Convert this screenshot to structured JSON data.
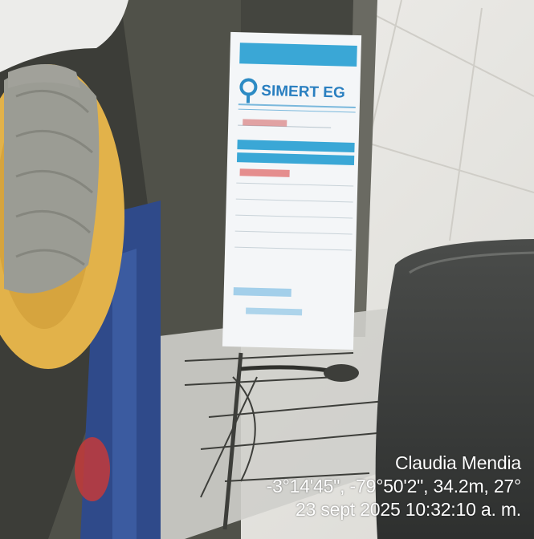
{
  "photo": {
    "description_icon": "camera-photo",
    "colors": {
      "dark_frame": "#2e2f2a",
      "hat_straw": "#9a9a90",
      "hat_brim": "#e7b84a",
      "ticket_header": "#3aa7d6",
      "window_light": "#e9e8e4"
    }
  },
  "ticket": {
    "brand": "SIMERT EG"
  },
  "stamp": {
    "author": "Claudia Mendia",
    "coordinates": "-3°14'45\", -79°50'2\", 34.2m, 27°",
    "datetime": "23 sept 2025 10:32:10 a. m."
  }
}
